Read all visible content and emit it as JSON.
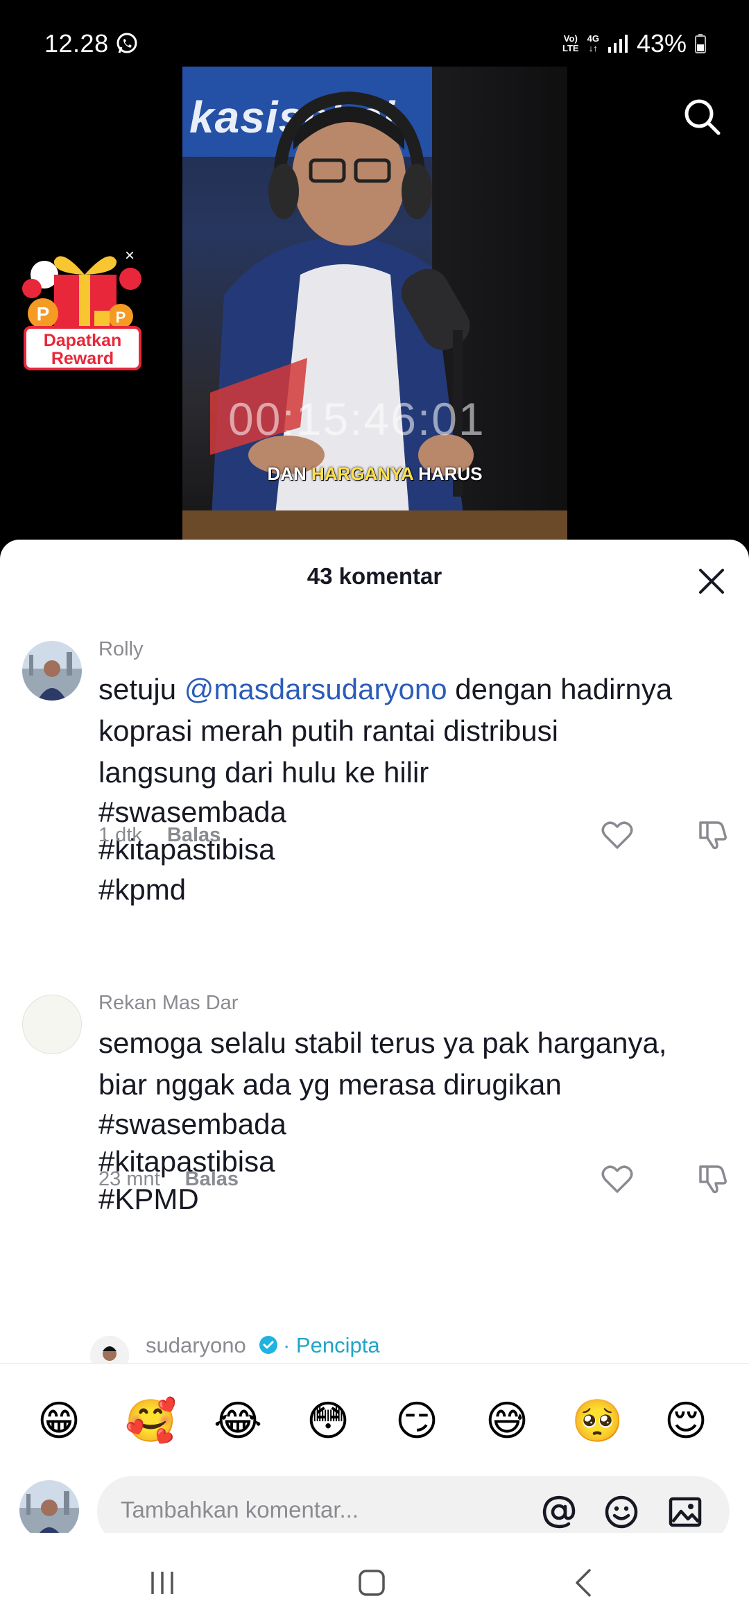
{
  "status_bar": {
    "time": "12.28",
    "volte": "Vo)\nLTE",
    "network": "4G",
    "battery": "43%"
  },
  "video": {
    "banner_text": "kasisebsi",
    "timer": "00:15:46:01",
    "caption_pre": "DAN ",
    "caption_highlight": "HARGANYA",
    "caption_post": " HARUS"
  },
  "reward": {
    "label_line1": "Dapatkan",
    "label_line2": "Reward",
    "close": "×"
  },
  "sheet": {
    "title": "43 komentar"
  },
  "comments": [
    {
      "user": "Rolly",
      "text_pre": "setuju ",
      "mention": "@masdarsudaryono",
      "text_post": " dengan hadirnya koprasi merah putih rantai distribusi langsung dari hulu ke hilir",
      "tags": [
        "#swasembada",
        "#kitapastibisa",
        "#kpmd"
      ],
      "time": "1 dtk",
      "reply": "Balas"
    },
    {
      "user": "Rekan Mas Dar",
      "text": "semoga selalu stabil terus ya pak harganya, biar nggak ada yg merasa dirugikan",
      "tags": [
        "#swasembada",
        "#kitapastibisa",
        "#KPMD"
      ],
      "time": "23 mnt",
      "reply": "Balas"
    }
  ],
  "creator_reply": {
    "name": "sudaryono",
    "tag": "· Pencipta"
  },
  "emojis": [
    "😁",
    "🥰",
    "😂",
    "😳",
    "😏",
    "😅",
    "🥺",
    "😌"
  ],
  "input": {
    "placeholder": "Tambahkan komentar..."
  },
  "colors": {
    "mention": "#2b5db9",
    "creator_tag": "#20a5c7",
    "reward_red": "#e8283a"
  }
}
